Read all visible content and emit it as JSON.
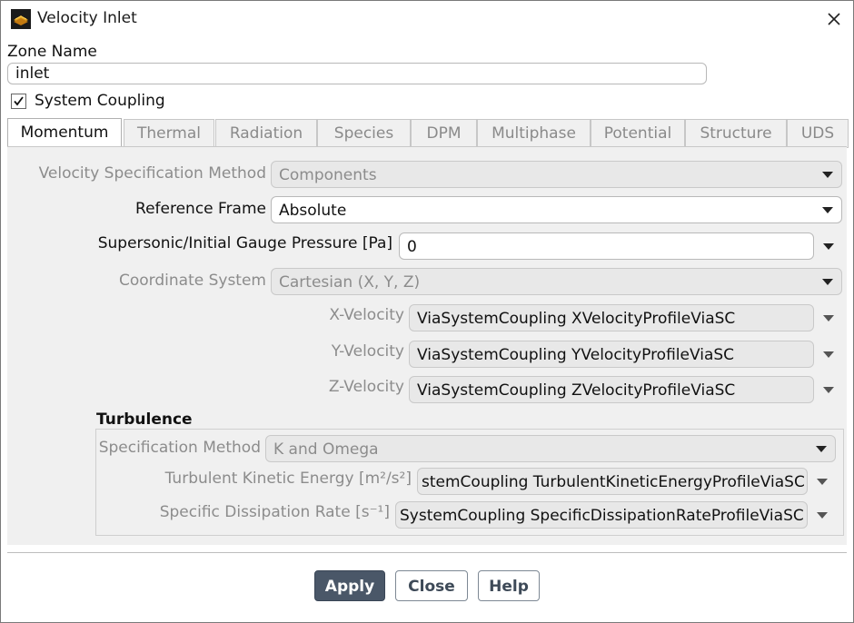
{
  "window": {
    "title": "Velocity Inlet"
  },
  "zone": {
    "label": "Zone Name",
    "value": "inlet"
  },
  "system_coupling": {
    "label": "System Coupling",
    "checked": true
  },
  "tabs": [
    {
      "label": "Momentum",
      "active": true
    },
    {
      "label": "Thermal"
    },
    {
      "label": "Radiation"
    },
    {
      "label": "Species"
    },
    {
      "label": "DPM"
    },
    {
      "label": "Multiphase"
    },
    {
      "label": "Potential"
    },
    {
      "label": "Structure"
    },
    {
      "label": "UDS"
    }
  ],
  "momentum": {
    "velocity_spec": {
      "label": "Velocity Specification Method",
      "value": "Components"
    },
    "reference_frame": {
      "label": "Reference Frame",
      "value": "Absolute"
    },
    "pressure": {
      "label": "Supersonic/Initial Gauge Pressure [Pa]",
      "value": "0"
    },
    "coordinate_system": {
      "label": "Coordinate System",
      "value": "Cartesian (X, Y, Z)"
    },
    "x_velocity": {
      "label": "X-Velocity",
      "value": "ViaSystemCoupling XVelocityProfileViaSC"
    },
    "y_velocity": {
      "label": "Y-Velocity",
      "value": "ViaSystemCoupling YVelocityProfileViaSC"
    },
    "z_velocity": {
      "label": "Z-Velocity",
      "value": "ViaSystemCoupling ZVelocityProfileViaSC"
    }
  },
  "turbulence": {
    "heading": "Turbulence",
    "spec_method": {
      "label": "Specification Method",
      "value": "K and Omega"
    },
    "tke": {
      "label": "Turbulent Kinetic Energy [m²/s²]",
      "value": "stemCoupling TurbulentKineticEnergyProfileViaSC"
    },
    "sdr": {
      "label": "Specific Dissipation Rate [s⁻¹]",
      "value": "SystemCoupling SpecificDissipationRateProfileViaSC"
    }
  },
  "buttons": {
    "apply": "Apply",
    "close": "Close",
    "help": "Help"
  },
  "icons": {
    "app": "fluent-app-icon",
    "close": "close-icon",
    "dropdown": "chevron-down-icon",
    "check": "check-icon"
  },
  "colors": {
    "primary_button": "#4a5768",
    "panel_bg": "#f0f0f0"
  }
}
